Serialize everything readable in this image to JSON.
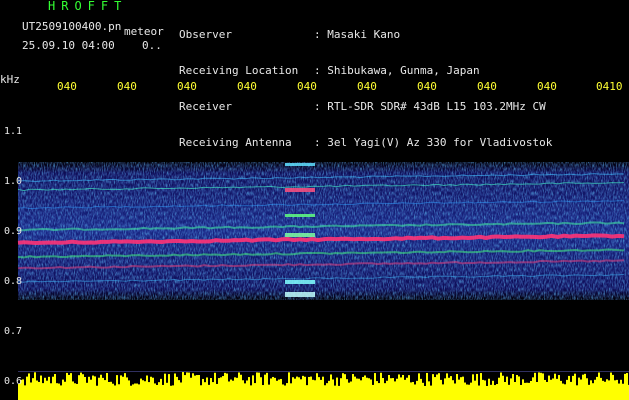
{
  "header": {
    "brand": "HROFFT",
    "filename": "UT2509100400.pn",
    "kind": "meteor",
    "datetime": "25.09.10 04:00",
    "count": "0.."
  },
  "station": {
    "observer": {
      "label": "Observer",
      "value": ": Masaki Kano"
    },
    "location": {
      "label": "Receiving Location",
      "value": ": Shibukawa, Gunma, Japan"
    },
    "receiver": {
      "label": "Receiver",
      "value": ": RTL-SDR SDR# 43dB L15 103.2MHz CW"
    },
    "antenna": {
      "label": "Receiving Antenna",
      "value": ": 3el Yagi(V) Az 330 for Vladivostok"
    }
  },
  "axis": {
    "y_unit": "kHz",
    "y_ticks": [
      "1.1",
      "1.0",
      "0.9",
      "0.8",
      "0.7",
      "0.6"
    ],
    "time_ticks": [
      "040",
      "040",
      "040",
      "040",
      "040",
      "040",
      "040",
      "040",
      "040",
      "0410"
    ]
  },
  "colors": {
    "background": "#000000",
    "header_text": "#33ff33",
    "info_text": "#e8e8e8",
    "axis_text": "#ffff33",
    "meteor_echo": "#ff3377",
    "noise_bar": "#ffff00"
  }
}
